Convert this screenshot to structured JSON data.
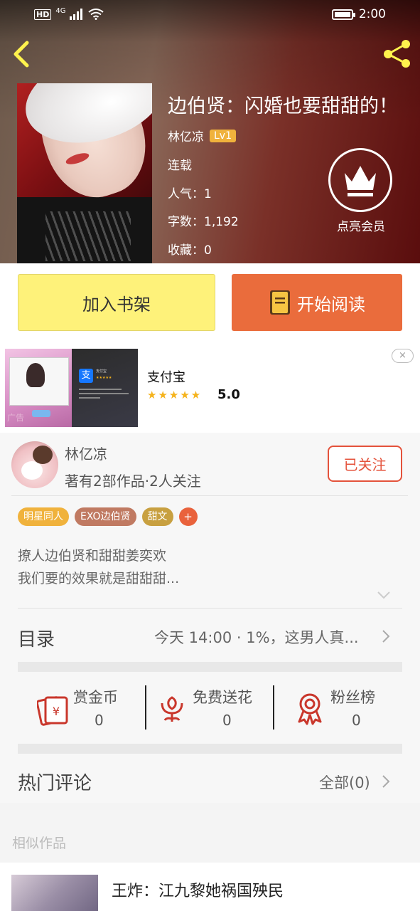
{
  "status_bar": {
    "hd": "HD",
    "network": "4G",
    "time": "2:00"
  },
  "book": {
    "title": "边伯贤：闪婚也要甜甜的！",
    "author": "林亿凉",
    "level": "Lv1",
    "status": "连载",
    "popularity": "人气：1",
    "word_count": "字数：1,192",
    "favorites": "收藏：0"
  },
  "vip": {
    "label": "点亮会员"
  },
  "actions": {
    "add_shelf": "加入书架",
    "start_reading": "开始阅读"
  },
  "ad": {
    "app_name": "支付宝",
    "stars": "★★★★★",
    "rating": "5.0",
    "tag": "广告",
    "close": "×",
    "thumb_title": "支付宝",
    "thumb_stars": "★★★★★"
  },
  "author_card": {
    "name": "林亿凉",
    "stats": "著有2部作品·2人关注",
    "follow_label": "已关注"
  },
  "tags": [
    {
      "label": "明星同人",
      "color": "#f0b23c"
    },
    {
      "label": "EXO边伯贤",
      "color": "#c07a62"
    },
    {
      "label": "甜文",
      "color": "#c8a040"
    }
  ],
  "tag_add": "+",
  "intro": {
    "line1": "撩人边伯贤和甜甜姜奕欢",
    "line2": "我们要的效果就是甜甜甜..."
  },
  "toc": {
    "label": "目录",
    "latest": "今天 14:00 · 1%，这男人真..."
  },
  "rewards": [
    {
      "label": "赏金币",
      "value": "0",
      "icon": "coin-envelope-icon"
    },
    {
      "label": "免费送花",
      "value": "0",
      "icon": "flower-icon"
    },
    {
      "label": "粉丝榜",
      "value": "0",
      "icon": "medal-icon"
    }
  ],
  "comments": {
    "label": "热门评论",
    "all": "全部(0)"
  },
  "similar": {
    "label": "相似作品",
    "items": [
      {
        "title": "王炸：江九黎她祸国殃民"
      }
    ]
  },
  "colors": {
    "accent_orange": "#ea6c3c",
    "shelf_yellow": "#fef27a",
    "follow_red": "#e4523b",
    "icon_red": "#c9372c"
  }
}
